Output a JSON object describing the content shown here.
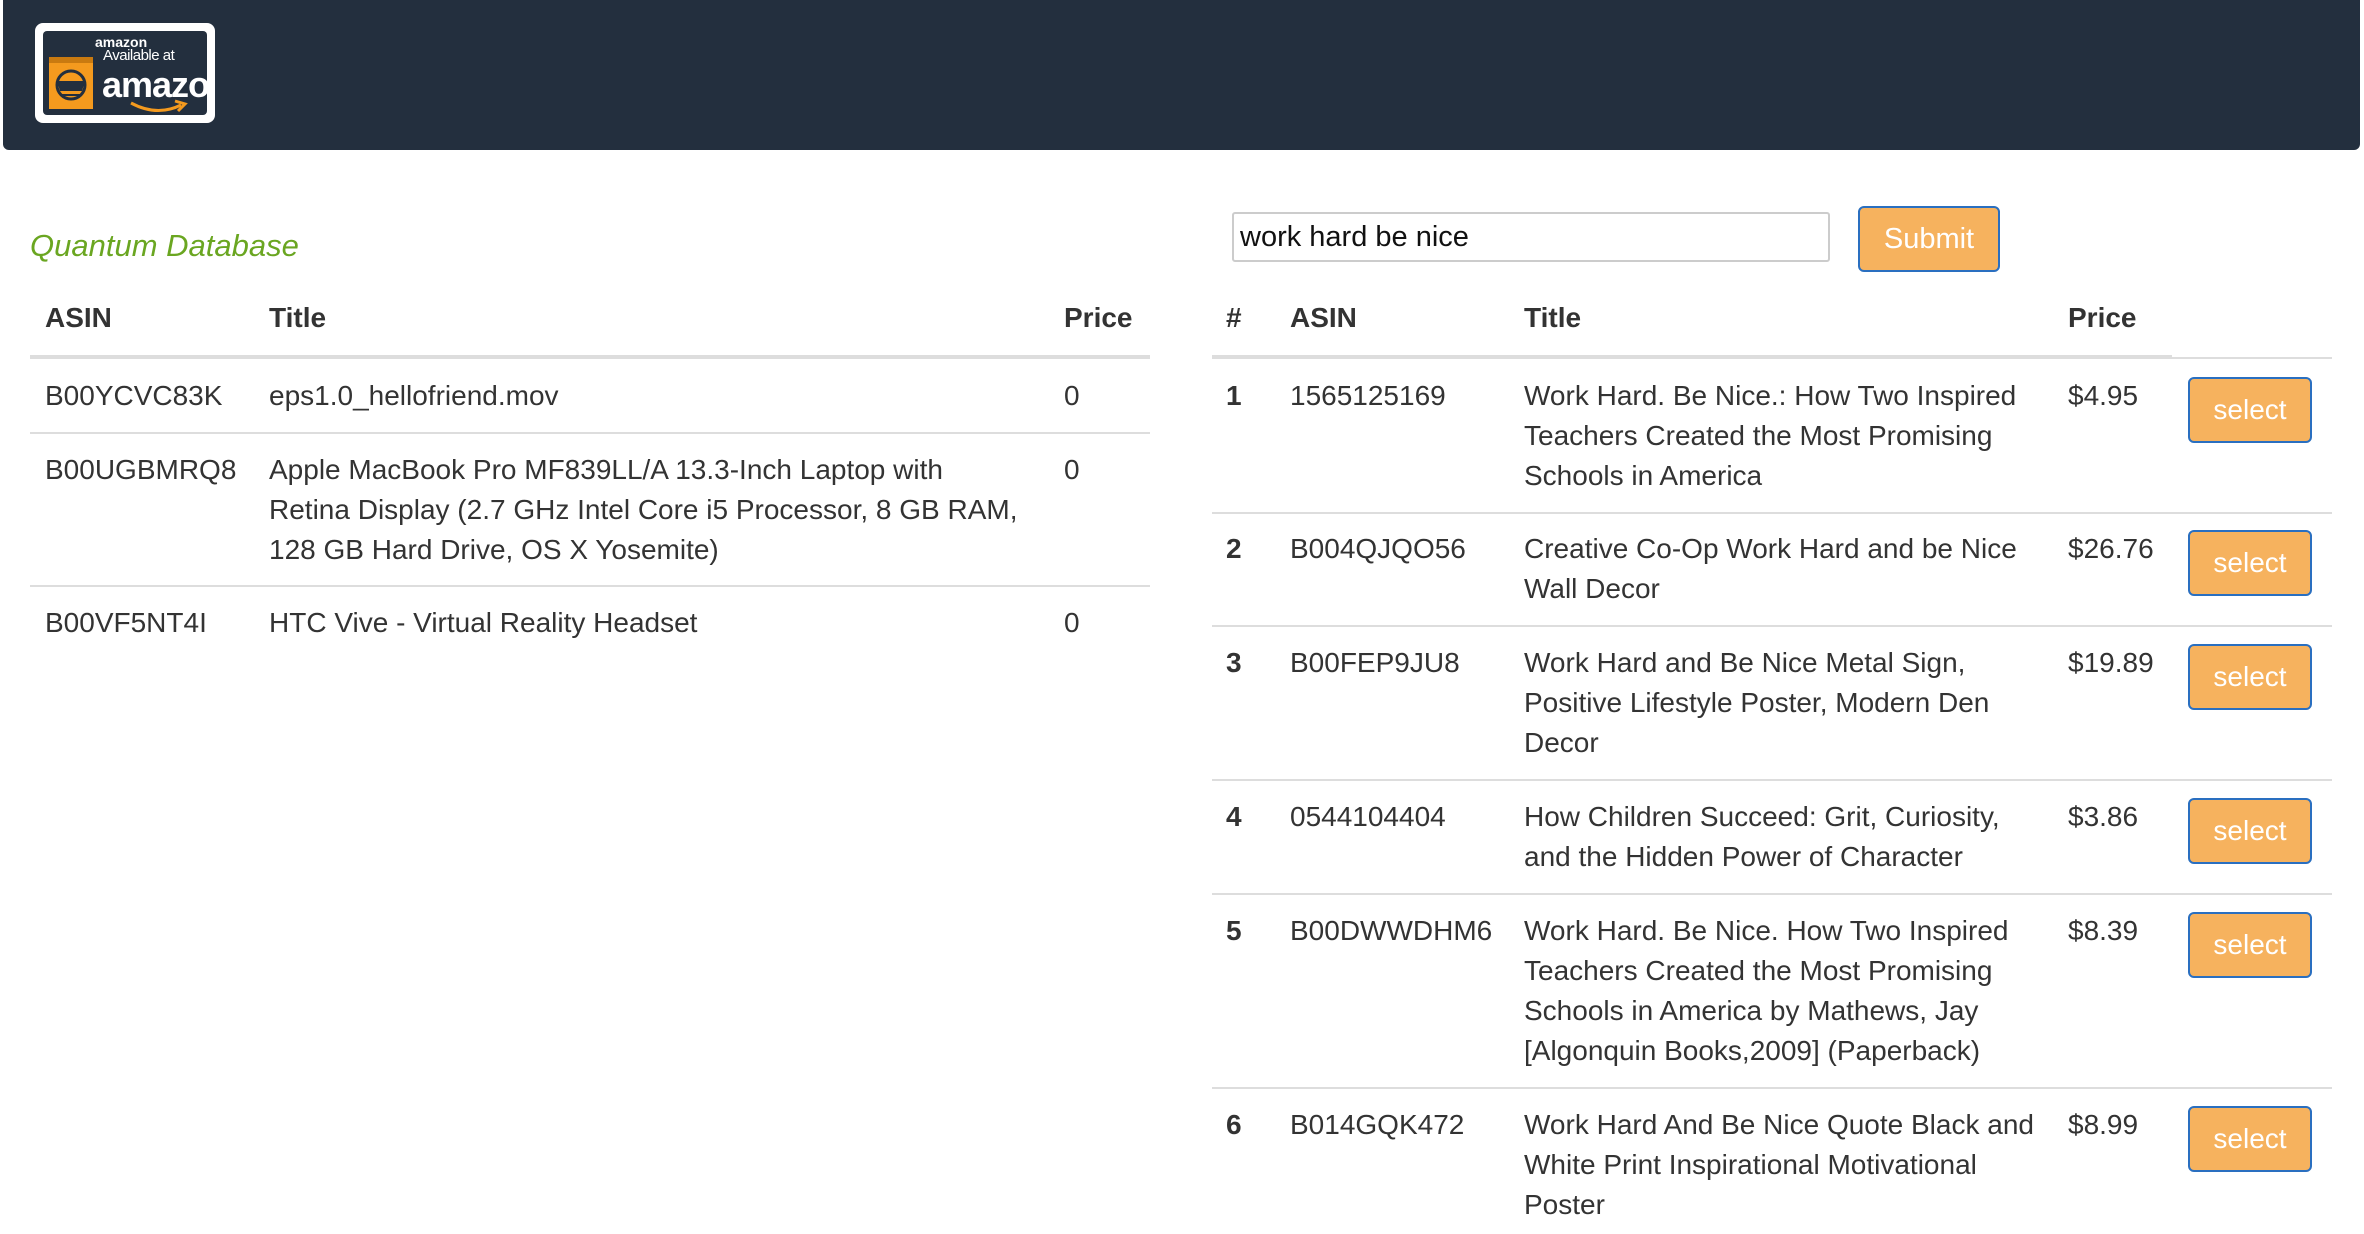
{
  "header": {
    "badge": {
      "small_text": "amazon",
      "available_text": "Available at",
      "brand_text": "amazon"
    },
    "colors": {
      "bar": "#232f3e",
      "accent": "#f6b25e",
      "title_green": "#6aa621"
    }
  },
  "database": {
    "title": "Quantum Database",
    "columns": {
      "asin": "ASIN",
      "title": "Title",
      "price": "Price"
    },
    "rows": [
      {
        "asin": "B00YCVC83K",
        "title": "eps1.0_hellofriend.mov",
        "price": "0"
      },
      {
        "asin": "B00UGBMRQ8",
        "title": "Apple MacBook Pro MF839LL/A 13.3-Inch Laptop with Retina Display (2.7 GHz Intel Core i5 Processor, 8 GB RAM, 128 GB Hard Drive, OS X Yosemite)",
        "price": "0"
      },
      {
        "asin": "B00VF5NT4I",
        "title": "HTC Vive - Virtual Reality Headset",
        "price": "0"
      }
    ]
  },
  "search": {
    "value": "work hard be nice",
    "submit_label": "Submit"
  },
  "results": {
    "columns": {
      "num": "#",
      "asin": "ASIN",
      "title": "Title",
      "price": "Price"
    },
    "select_label": "select",
    "rows": [
      {
        "num": "1",
        "asin": "1565125169",
        "title": "Work Hard. Be Nice.: How Two Inspired Teachers Created the Most Promising Schools in America",
        "price": "$4.95"
      },
      {
        "num": "2",
        "asin": "B004QJQO56",
        "title": "Creative Co-Op Work Hard and be Nice Wall Decor",
        "price": "$26.76"
      },
      {
        "num": "3",
        "asin": "B00FEP9JU8",
        "title": "Work Hard and Be Nice Metal Sign, Positive Lifestyle Poster, Modern Den Decor",
        "price": "$19.89"
      },
      {
        "num": "4",
        "asin": "0544104404",
        "title": "How Children Succeed: Grit, Curiosity, and the Hidden Power of Character",
        "price": "$3.86"
      },
      {
        "num": "5",
        "asin": "B00DWWDHM6",
        "title": "Work Hard. Be Nice. How Two Inspired Teachers Created the Most Promising Schools in America by Mathews, Jay [Algonquin Books,2009] (Paperback)",
        "price": "$8.39"
      },
      {
        "num": "6",
        "asin": "B014GQK472",
        "title": "Work Hard And Be Nice Quote Black and White Print Inspirational Motivational Poster",
        "price": "$8.99"
      }
    ]
  }
}
